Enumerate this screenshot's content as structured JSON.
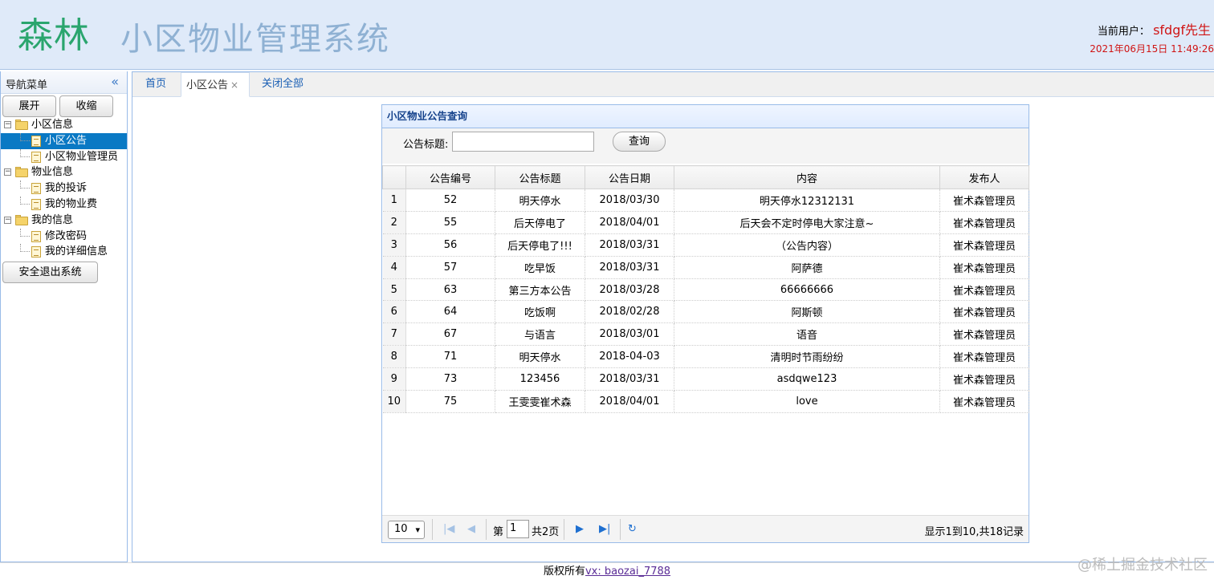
{
  "header": {
    "logo_main": "森林",
    "system_title": "小区物业管理系统",
    "user_label": "当前用户：",
    "user_name": "sfdgf先生",
    "datetime": "2021年06月15日 11:49:26"
  },
  "sidebar": {
    "title": "导航菜单",
    "collapse_glyph": "«",
    "expand_label": "展开",
    "collapse_label": "收缩",
    "groups": [
      {
        "label": "小区信息",
        "items": [
          "小区公告",
          "小区物业管理员"
        ]
      },
      {
        "label": "物业信息",
        "items": [
          "我的投诉",
          "我的物业费"
        ]
      },
      {
        "label": "我的信息",
        "items": [
          "修改密码",
          "我的详细信息"
        ]
      }
    ],
    "selected": "小区公告",
    "logout_label": "安全退出系统"
  },
  "tabs": {
    "home": "首页",
    "notice": "小区公告",
    "close_all": "关闭全部"
  },
  "panel": {
    "title": "小区物业公告查询",
    "search_label": "公告标题:",
    "search_value": "",
    "search_button": "查询",
    "columns": [
      "公告编号",
      "公告标题",
      "公告日期",
      "内容",
      "发布人"
    ],
    "rows": [
      [
        "1",
        "52",
        "明天停水",
        "2018/03/30",
        "明天停水12312131",
        "崔术森管理员"
      ],
      [
        "2",
        "55",
        "后天停电了",
        "2018/04/01",
        "后天会不定时停电大家注意~",
        "崔术森管理员"
      ],
      [
        "3",
        "56",
        "后天停电了!!!",
        "2018/03/31",
        "（公告内容）",
        "崔术森管理员"
      ],
      [
        "4",
        "57",
        "吃早饭",
        "2018/03/31",
        "阿萨德",
        "崔术森管理员"
      ],
      [
        "5",
        "63",
        "第三方本公告",
        "2018/03/28",
        "66666666",
        "崔术森管理员"
      ],
      [
        "6",
        "64",
        "吃饭啊",
        "2018/02/28",
        "阿斯顿",
        "崔术森管理员"
      ],
      [
        "7",
        "67",
        "与语言",
        "2018/03/01",
        "语音",
        "崔术森管理员"
      ],
      [
        "8",
        "71",
        "明天停水",
        "2018-04-03",
        "清明时节雨纷纷",
        "崔术森管理员"
      ],
      [
        "9",
        "73",
        "123456",
        "2018/03/31",
        "asdqwe123",
        "崔术森管理员"
      ],
      [
        "10",
        "75",
        "王雯雯崔术森",
        "2018/04/01",
        "love",
        "崔术森管理员"
      ]
    ],
    "pager": {
      "page_size": "10",
      "page_label_before": "第",
      "current_page": "1",
      "page_label_after": "共2页",
      "info": "显示1到10,共18记录"
    }
  },
  "footer": {
    "copyright": "版权所有",
    "contact": "vx: baozai_7788"
  },
  "watermark": "@稀土掘金技术社区"
}
